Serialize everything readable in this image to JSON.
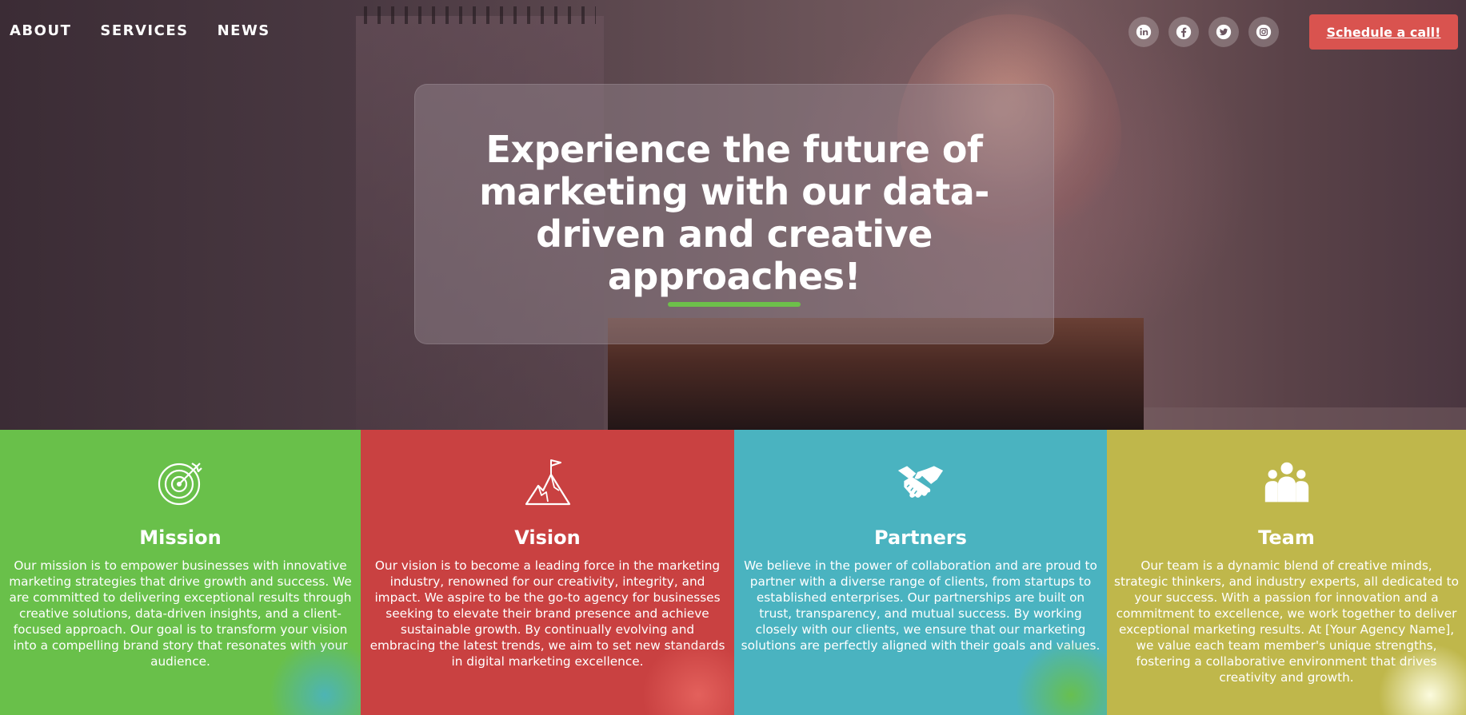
{
  "nav": {
    "items": [
      {
        "label": "ABOUT"
      },
      {
        "label": "SERVICES"
      },
      {
        "label": "NEWS"
      }
    ]
  },
  "social": {
    "icons": [
      "linkedin-icon",
      "facebook-icon",
      "twitter-icon",
      "instagram-icon"
    ]
  },
  "cta": {
    "label": "Schedule a call!"
  },
  "hero": {
    "headline": "Experience the future of marketing with our data-driven and creative approaches!",
    "accent_color": "#6dc04a"
  },
  "cards": [
    {
      "icon": "target-icon",
      "title": "Mission",
      "text": "Our mission is to empower businesses with innovative marketing strategies that drive growth and success. We are committed to delivering exceptional results through creative solutions, data-driven insights, and a client-focused approach. Our goal is to transform your vision into a compelling brand story that resonates with your audience.",
      "color": "#69c04a"
    },
    {
      "icon": "mountain-flag-icon",
      "title": "Vision",
      "text": "Our vision is to become a leading force in the marketing industry, renowned for our creativity, integrity, and impact. We aspire to be the go-to agency for businesses seeking to elevate their brand presence and achieve sustainable growth. By continually evolving and embracing the latest trends, we aim to set new standards in digital marketing excellence.",
      "color": "#c94141"
    },
    {
      "icon": "handshake-icon",
      "title": "Partners",
      "text": "We believe in the power of collaboration and are proud to partner with a diverse range of clients, from startups to established enterprises. Our partnerships are built on trust, transparency, and mutual success. By working closely with our clients, we ensure that our marketing solutions are perfectly aligned with their goals and values.",
      "color": "#4ab3c0"
    },
    {
      "icon": "team-icon",
      "title": "Team",
      "text": "Our team is a dynamic blend of creative minds, strategic thinkers, and industry experts, all dedicated to your success. With a passion for innovation and a commitment to excellence, we work together to deliver exceptional marketing results. At [Your Agency Name], we value each team member's unique strengths, fostering a collaborative environment that drives creativity and growth.",
      "color": "#bfb74b"
    }
  ]
}
